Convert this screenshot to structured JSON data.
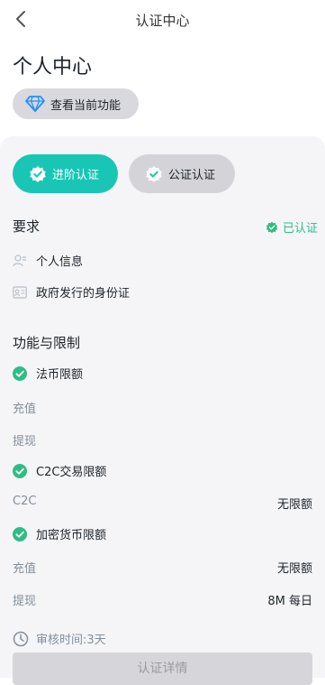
{
  "nav": {
    "title": "认证中心"
  },
  "header": {
    "title": "个人中心",
    "feature_button": "查看当前功能"
  },
  "tabs": [
    {
      "label": "进阶认证",
      "active": true
    },
    {
      "label": "公证认证",
      "active": false
    }
  ],
  "requirements": {
    "title": "要求",
    "status": "已认证",
    "items": [
      "个人信息",
      "政府发行的身份证"
    ]
  },
  "features": {
    "title": "功能与限制",
    "fiat": {
      "label": "法币限额",
      "rows": [
        {
          "k": "充值",
          "v": ""
        },
        {
          "k": "提现",
          "v": ""
        }
      ]
    },
    "c2c": {
      "label": "C2C交易限额",
      "rows": [
        {
          "k": "C2C",
          "v": "无限额"
        }
      ]
    },
    "crypto": {
      "label": "加密货币限额",
      "rows": [
        {
          "k": "充值",
          "v": "无限额"
        },
        {
          "k": "提现",
          "v": "8M 每日"
        }
      ]
    }
  },
  "review_time": "审核时间:3天",
  "cta_label": "认证详情",
  "colors": {
    "accent": "#19c6b6",
    "success": "#2ebd85",
    "muted": "#848e9c"
  }
}
